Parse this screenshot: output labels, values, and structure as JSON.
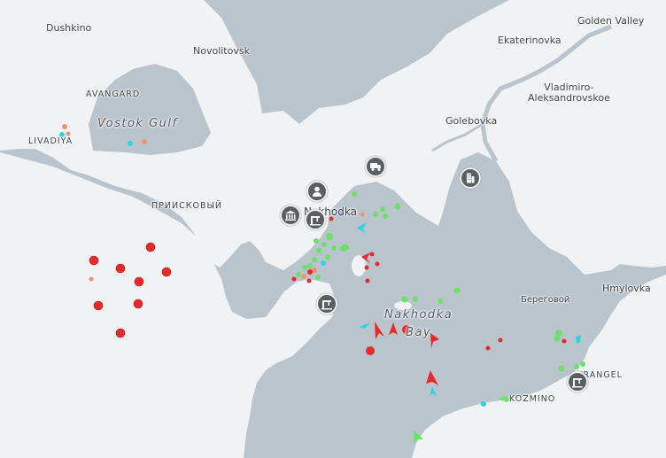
{
  "map": {
    "colors": {
      "water": "#b9c4cd",
      "land": "#f1f2f3",
      "vessel_red": "#e8282b",
      "vessel_green": "#6fdf6b",
      "vessel_cyan": "#2ed3e3",
      "vessel_orange": "#f19275",
      "port_icon_bg": "#5a5f64"
    },
    "places": [
      {
        "name": "Dushkino",
        "style": "land"
      },
      {
        "name": "Novolitovsk",
        "style": "land"
      },
      {
        "name": "Golden Valley",
        "style": "land"
      },
      {
        "name": "Ekaterinovka",
        "style": "land"
      },
      {
        "name": "AVANGARD",
        "style": "caps"
      },
      {
        "name": "Vladimiro-\nAleksandrovskoe",
        "style": "land"
      },
      {
        "name": "Vostok Gulf",
        "style": "water"
      },
      {
        "name": "LIVADIYA",
        "style": "caps"
      },
      {
        "name": "Golebovka",
        "style": "land"
      },
      {
        "name": "ПРИИСКОВЫЙ",
        "style": "caps"
      },
      {
        "name": "Nakhodka",
        "style": "land"
      },
      {
        "name": "Береговой",
        "style": "land"
      },
      {
        "name": "Hmylovka",
        "style": "land"
      },
      {
        "name": "Nakhodka\nBay",
        "style": "water"
      },
      {
        "name": "VRANGEL",
        "style": "caps"
      },
      {
        "name": "KOZMINO",
        "style": "caps"
      }
    ],
    "port_icons": [
      {
        "name": "truck-icon"
      },
      {
        "name": "person-icon"
      },
      {
        "name": "government-building-icon"
      },
      {
        "name": "port-crane-icon"
      },
      {
        "name": "office-building-icon"
      },
      {
        "name": "port-crane-icon"
      },
      {
        "name": "port-crane-icon"
      }
    ]
  }
}
